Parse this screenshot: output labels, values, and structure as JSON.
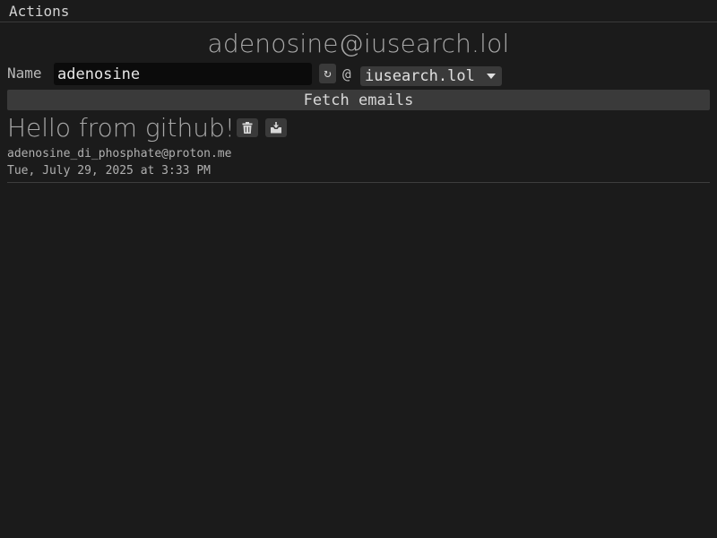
{
  "menubar": {
    "actions_label": "Actions"
  },
  "header": {
    "address": "adenosine@iusearch.lol"
  },
  "form": {
    "name_label": "Name",
    "name_value": "adenosine",
    "refresh_glyph": "↻",
    "at_sign": "@",
    "domain_selected": "iusearch.lol",
    "fetch_label": "Fetch emails"
  },
  "emails": [
    {
      "subject": "Hello from github!",
      "sender": "adenosine_di_phosphate@proton.me",
      "date": "Tue, July 29, 2025 at 3:33 PM",
      "actions": [
        "trash-icon",
        "download-icon"
      ]
    }
  ],
  "colors": {
    "background": "#1b1b1b",
    "button": "#3a3a3a",
    "input_background": "#0b0b0b",
    "text": "#b9b9b9"
  }
}
